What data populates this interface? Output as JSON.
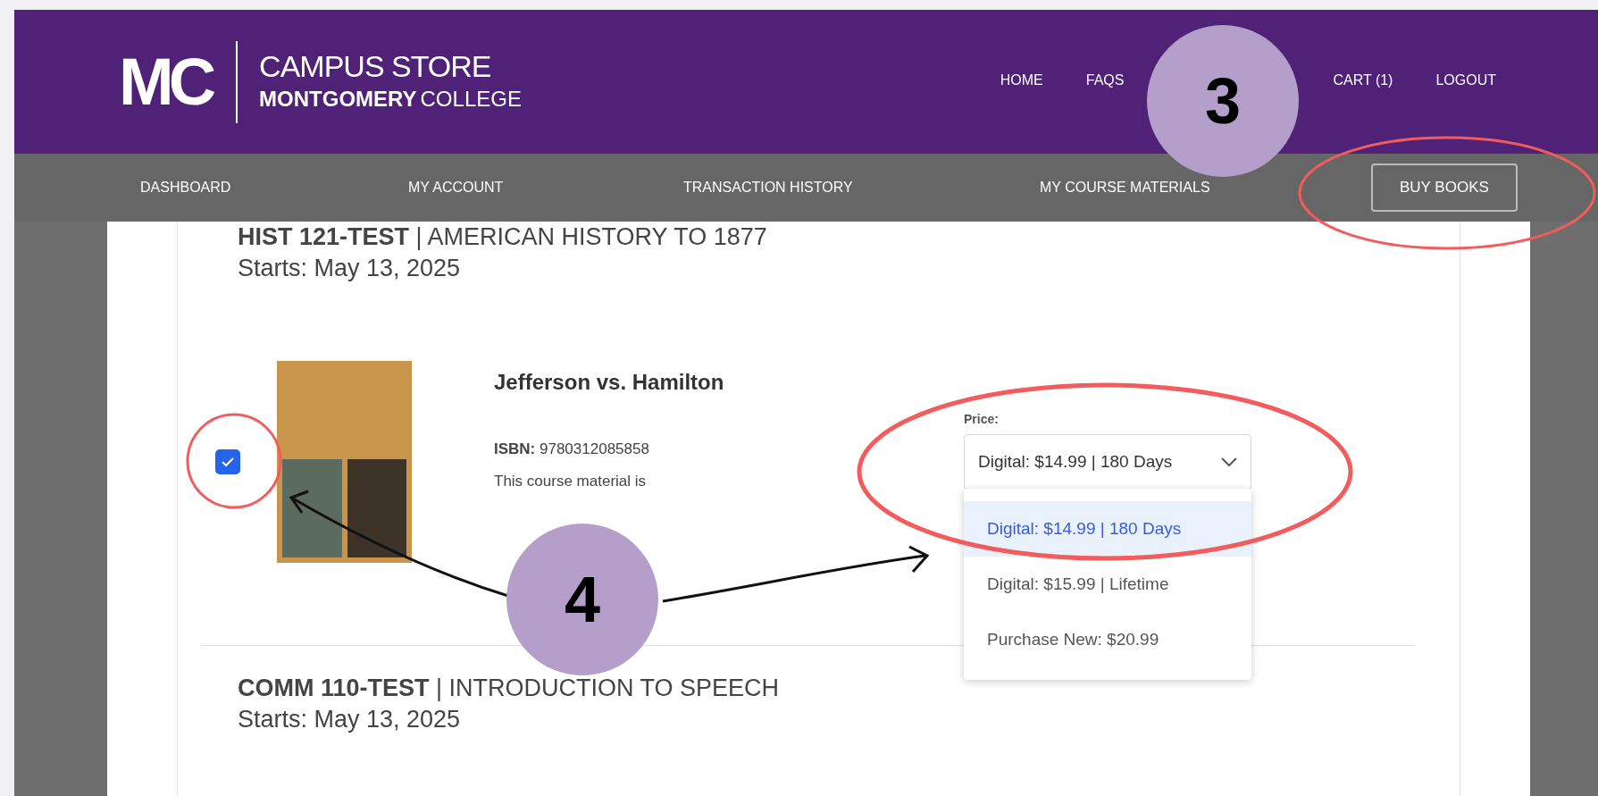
{
  "header": {
    "logo": "MC",
    "store_name": "CAMPUS STORE",
    "college_bold": "MONTGOMERY",
    "college_rest": "COLLEGE",
    "links": [
      "HOME",
      "FAQS",
      "CART (1)",
      "LOGOUT"
    ]
  },
  "nav": {
    "items": [
      "DASHBOARD",
      "MY ACCOUNT",
      "TRANSACTION HISTORY",
      "MY COURSE MATERIALS"
    ],
    "button": "BUY BOOKS"
  },
  "courses": [
    {
      "heading": "**HIST 121-TEST** | AMERICAN HISTORY TO 1877",
      "starts": "Starts: May 13, 2025",
      "materials": [
        {
          "title": "Jefferson vs. Hamilton",
          "isbn": "**ISBN:** 9780312085858",
          "note": "This course material is",
          "checked": true,
          "price_label": "Price:",
          "price_value": "Digital: $14.99 | 180 Days",
          "dropdown_open": true,
          "options": [
            {
              "label": "Digital: $14.99 | 180 Days",
              "selected": true
            },
            {
              "label": "Digital: $15.99 | Lifetime",
              "selected": false
            },
            {
              "label": "Purchase New: $20.99",
              "selected": false
            }
          ]
        }
      ]
    },
    {
      "heading": "**COMM 110-TEST** | INTRODUCTION TO SPEECH",
      "starts": "Starts: May 13, 2025"
    }
  ],
  "annotations": [
    {
      "kind": "step",
      "label": "3"
    },
    {
      "kind": "step",
      "label": "4"
    }
  ]
}
